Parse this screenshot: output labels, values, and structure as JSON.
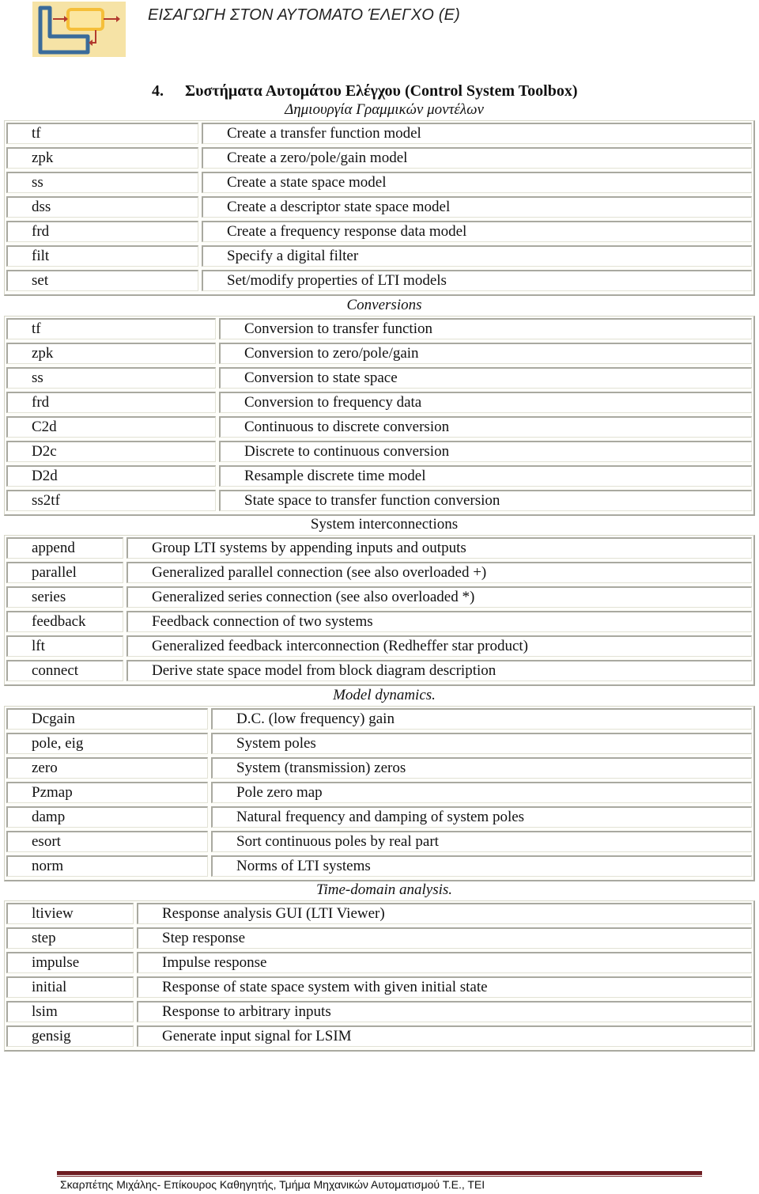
{
  "header": {
    "logo": "control-loop-logo-icon",
    "running_head": "ΕΙΣΑΓΩΓΗ ΣΤΟΝ ΑΥΤΟΜΑΤΟ ΈΛΕΓΧΟ  (Ε)"
  },
  "title": {
    "number": "4.",
    "text": "Συστήματα Αυτομάτου Ελέγχου (Control System Toolbox)"
  },
  "sections": [
    {
      "heading": "Δημιουργία Γραμμικών μοντέλων",
      "rows": [
        {
          "cmd": "tf",
          "desc": "Create a transfer function model"
        },
        {
          "cmd": "zpk",
          "desc": "Create a zero/pole/gain model"
        },
        {
          "cmd": "ss",
          "desc": "Create a state space model"
        },
        {
          "cmd": "dss",
          "desc": "Create a descriptor state space model"
        },
        {
          "cmd": "frd",
          "desc": "Create a frequency response data model"
        },
        {
          "cmd": "filt",
          "desc": "Specify a digital filter"
        },
        {
          "cmd": "set",
          "desc": "Set/modify properties of LTI models"
        }
      ]
    },
    {
      "heading": "Conversions",
      "rows": [
        {
          "cmd": "tf",
          "desc": "Conversion to transfer function"
        },
        {
          "cmd": "zpk",
          "desc": "Conversion to zero/pole/gain"
        },
        {
          "cmd": "ss",
          "desc": "Conversion to state space"
        },
        {
          "cmd": "frd",
          "desc": "Conversion to frequency data"
        },
        {
          "cmd": "C2d",
          "desc": "Continuous to discrete conversion"
        },
        {
          "cmd": "D2c",
          "desc": "Discrete to continuous conversion"
        },
        {
          "cmd": "D2d",
          "desc": "Resample discrete time model"
        },
        {
          "cmd": "ss2tf",
          "desc": "State space to transfer function conversion"
        }
      ]
    },
    {
      "heading": "System interconnections",
      "rows": [
        {
          "cmd": "append",
          "desc": "Group LTI systems by appending inputs and outputs"
        },
        {
          "cmd": "parallel",
          "desc": "Generalized parallel connection (see also overloaded +)"
        },
        {
          "cmd": "series",
          "desc": "Generalized series connection (see also overloaded *)"
        },
        {
          "cmd": "feedback",
          "desc": "Feedback connection of two systems"
        },
        {
          "cmd": "lft",
          "desc": "Generalized feedback interconnection (Redheffer star product)"
        },
        {
          "cmd": "connect",
          "desc": "Derive state space model from block diagram description"
        }
      ]
    },
    {
      "heading": "Model dynamics.",
      "rows": [
        {
          "cmd": "Dcgain",
          "desc": "D.C. (low frequency) gain"
        },
        {
          "cmd": "pole, eig",
          "desc": "System poles"
        },
        {
          "cmd": "zero",
          "desc": "System (transmission) zeros"
        },
        {
          "cmd": "Pzmap",
          "desc": "Pole zero map"
        },
        {
          "cmd": "damp",
          "desc": "Natural frequency and damping of system poles"
        },
        {
          "cmd": "esort",
          "desc": "Sort continuous poles by real part"
        },
        {
          "cmd": "norm",
          "desc": "Norms of LTI systems"
        }
      ]
    },
    {
      "heading": "Time-domain analysis.",
      "rows": [
        {
          "cmd": "ltiview",
          "desc": "Response analysis GUI (LTI Viewer)"
        },
        {
          "cmd": "step",
          "desc": "Step response"
        },
        {
          "cmd": "impulse",
          "desc": "Impulse response"
        },
        {
          "cmd": "initial",
          "desc": "Response of state space system with given initial state"
        },
        {
          "cmd": "lsim",
          "desc": "Response to arbitrary inputs"
        },
        {
          "cmd": "gensig",
          "desc": "Generate input signal for LSIM"
        }
      ]
    }
  ],
  "footer": {
    "text": "Σκαρπέτης Μιχάλης- Επίκουρος Καθηγητής, Τμήμα Μηχανικών Αυτοματισμού Τ.Ε., ΤΕΙ"
  }
}
